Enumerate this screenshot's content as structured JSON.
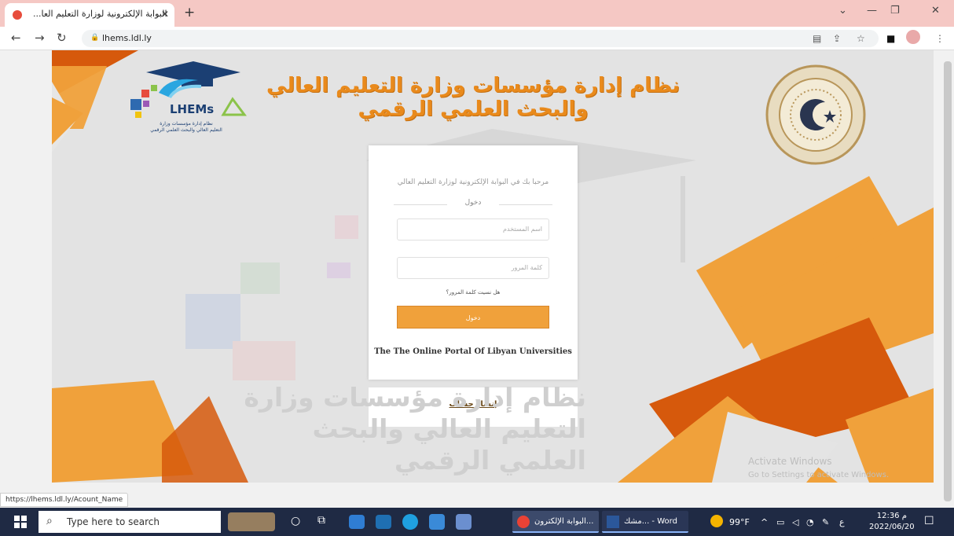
{
  "browser": {
    "tab_title": "البوابة الإلكترونية لوزارة التعليم العا...",
    "address": "lhems.ldl.ly",
    "status_url": "https://lhems.ldl.ly/Acount_Name"
  },
  "header": {
    "line1": "نظام إدارة مؤسسات وزارة التعليم العالي",
    "line2": "والبحث العلمي الرقمي",
    "logo_text": "LHEMs",
    "logo_sub1": "نظام إدارة مؤسسات وزارة",
    "logo_sub2": "التعليم العالي والبحث العلمي الرقمي"
  },
  "login": {
    "welcome": "مرحبا بك في البوابة الإلكترونية لوزارة التعليم العالي",
    "section_title": "دخول",
    "username_placeholder": "اسم المستخدم",
    "password_placeholder": "كلمة المرور",
    "forgot": "هل نسيت كلمة المرور؟",
    "submit": "دخول",
    "portal_name": "The The Online Portal Of Libyan Universities",
    "register": "إنشاء حساب"
  },
  "watermark": {
    "line1": "نظام إدارة مؤسسات وزارة",
    "line2": "التعليم العالي والبحث العلمي الرقمي",
    "activate1": "Activate Windows",
    "activate2": "Go to Settings to activate Windows."
  },
  "taskbar": {
    "search_placeholder": "Type here to search",
    "app_browser": "البوابة الإلكترون...",
    "app_word": "مشك... - Word",
    "weather": "99°F",
    "lang": "ع",
    "time": "12:36 م",
    "date": "2022/06/20"
  },
  "colors": {
    "accent": "#f0a13b",
    "orange_dark": "#d6590c",
    "taskbar": "#1f2a44"
  }
}
